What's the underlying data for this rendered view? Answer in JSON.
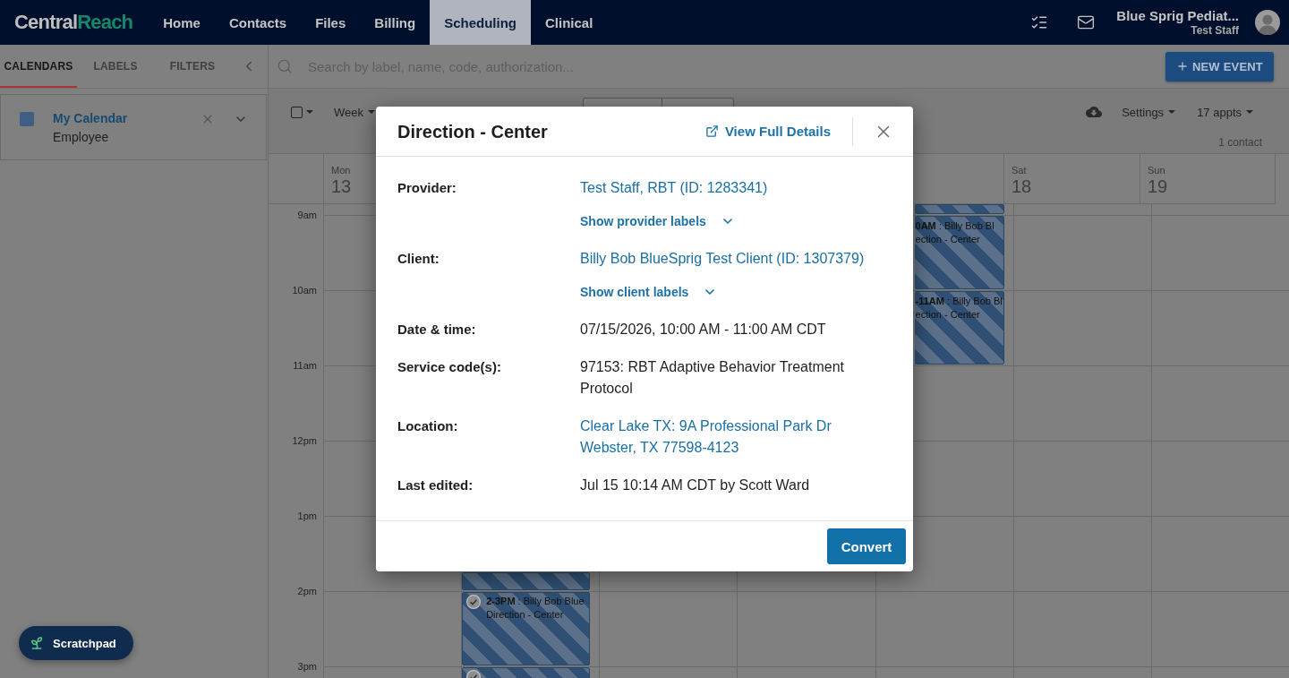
{
  "nav": {
    "logo": {
      "first": "Central",
      "second": "Reach"
    },
    "items": [
      {
        "label": "Home",
        "selected": false
      },
      {
        "label": "Contacts",
        "selected": false
      },
      {
        "label": "Files",
        "selected": false
      },
      {
        "label": "Billing",
        "selected": false
      },
      {
        "label": "Scheduling",
        "selected": true
      },
      {
        "label": "Clinical",
        "selected": false
      }
    ],
    "account": {
      "organization": "Blue Sprig Pediat...",
      "user": "Test Staff"
    }
  },
  "sidebar": {
    "tabs": [
      {
        "label": "CALENDARS",
        "selected": true
      },
      {
        "label": "LABELS",
        "selected": false
      },
      {
        "label": "FILTERS",
        "selected": false
      }
    ],
    "calendars": [
      {
        "name": "My Calendar",
        "type": "Employee",
        "color": "#3d5f86"
      }
    ]
  },
  "search": {
    "placeholder": "Search by label, name, code, authorization..."
  },
  "new_event_button": {
    "label": "NEW EVENT"
  },
  "toolbar": {
    "select_all": {
      "checked": false
    },
    "view": "Week",
    "settings": "Settings",
    "appointments": "17 appts",
    "contacts": "1 contact"
  },
  "calendar": {
    "hours": [
      "9am",
      "10am",
      "11am",
      "12pm",
      "1pm",
      "2pm",
      "3pm"
    ],
    "columns": [
      {
        "day": "Mon",
        "date": "13"
      },
      {
        "time_slots": [
          {
            "kind": "free"
          },
          {
            "kind": "free"
          },
          {
            "kind": "free"
          },
          {
            "kind": "free"
          },
          {
            "kind": "free"
          },
          {
            "kind": "appointment"
          },
          {
            "kind": "appointment",
            "checked": true,
            "title": "**2-3PM** : Billy Bob Blue",
            "service": "Direction - Center"
          },
          {
            "kind": "appointment",
            "checked": true
          }
        ]
      },
      {},
      {},
      {
        "time_slots": [
          {
            "kind": "appointment"
          },
          {
            "kind": "appointment",
            "title": "**0AM** : Billy Bob Bl",
            "service": "ection - Center"
          },
          {
            "kind": "appointment",
            "title": "**-11AM** : Billy Bob Bl",
            "service": "ection - Center"
          }
        ]
      },
      {
        "day": "Sat",
        "date": "18"
      },
      {
        "day": "Sun",
        "date": "19"
      }
    ]
  },
  "event_dialog": {
    "title": "Direction - Center",
    "details_link": "View Full Details",
    "fields": [
      {
        "kind": "link",
        "label": "Provider:",
        "value": "Test Staff, RBT (ID: 1283341)",
        "toggle": "Show provider labels"
      },
      {
        "kind": "link",
        "label": "Client:",
        "value": "Billy Bob BlueSprig Test Client (ID: 1307379)",
        "toggle": "Show client labels"
      },
      {
        "kind": "text",
        "label": "Date & time:",
        "value": "07/15/2026, 10:00 AM - 11:00 AM CDT"
      },
      {
        "kind": "text",
        "label": "Service code(s):",
        "value": "97153: RBT Adaptive Behavior Treatment Protocol"
      },
      {
        "kind": "address",
        "label": "Location:",
        "lines": [
          "Clear Lake TX: 9A Professional Park Dr",
          "Webster, TX 77598-4123"
        ]
      },
      {
        "kind": "text",
        "label": "Last edited:",
        "value": "Jul 15 10:14 AM CDT by Scott Ward"
      }
    ],
    "primary_button": "Convert"
  },
  "scratchpad": {
    "label": "Scratchpad"
  }
}
